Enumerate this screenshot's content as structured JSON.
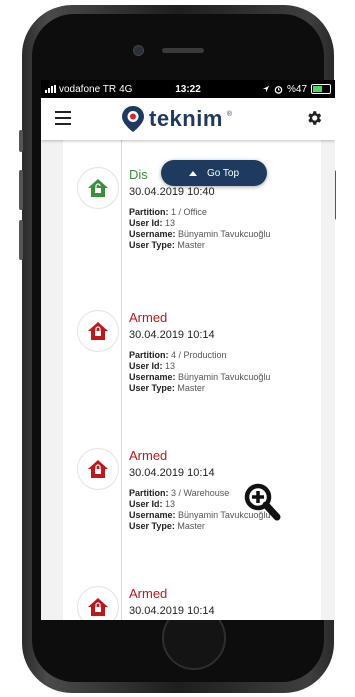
{
  "status_bar": {
    "carrier": "vodafone TR",
    "network": "4G",
    "time": "13:22",
    "battery": "%47"
  },
  "header": {
    "logo_text": "teknim",
    "logo_reg": "®",
    "menu_icon": "hamburger-icon",
    "settings_icon": "gear-icon"
  },
  "go_top_label": "Go Top",
  "colors": {
    "brand": "#1f3a5f",
    "armed": "#c0171d",
    "disarmed": "#3c8f3c"
  },
  "labels": {
    "partition": "Partition:",
    "user_id": "User Id:",
    "username": "Username:",
    "user_type": "User Type:"
  },
  "events": [
    {
      "status": "Disarmed",
      "status_visible": "Dis",
      "time": "30.04.2019 10:40",
      "partition": "1 / Office",
      "user_id": "13",
      "username": "Bünyamin Tavukcuoğlu",
      "user_type": "Master"
    },
    {
      "status": "Armed",
      "time": "30.04.2019 10:14",
      "partition": "4 / Production",
      "user_id": "13",
      "username": "Bünyamin Tavukcuoğlu",
      "user_type": "Master"
    },
    {
      "status": "Armed",
      "time": "30.04.2019 10:14",
      "partition": "3 / Warehouse",
      "user_id": "13",
      "username": "Bünyamin Tavukcuoğlu",
      "user_type": "Master"
    },
    {
      "status": "Armed",
      "time": "30.04.2019 10:14"
    }
  ],
  "zoom_icon": "zoom-in-icon"
}
